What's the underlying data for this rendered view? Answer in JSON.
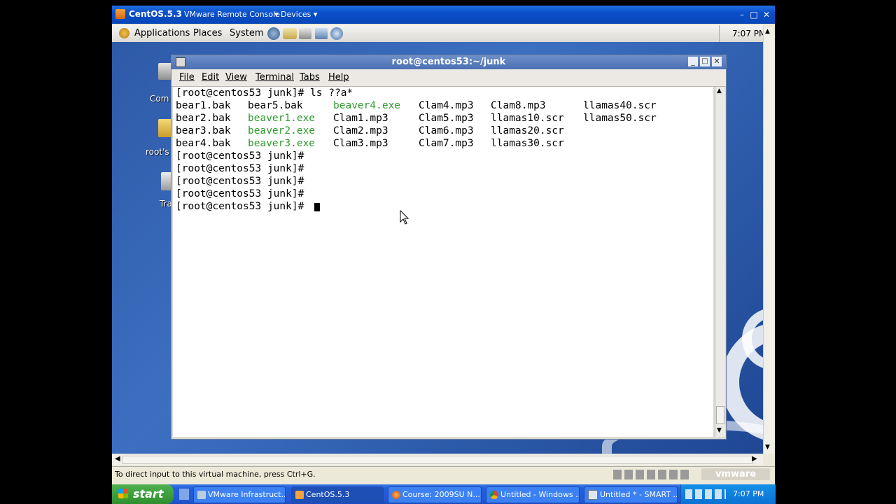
{
  "console": {
    "title": "CentOS.5.3",
    "subtitle": "VMware Remote Console",
    "devices": "Devices",
    "status_text": "To direct input to this virtual machine, press Ctrl+G.",
    "vmware_logo": "vmware"
  },
  "gnome": {
    "menus": [
      "Applications",
      "Places",
      "System"
    ],
    "clock": "7:07 PM",
    "launchers": [
      "network-icon",
      "mail-icon",
      "editor-icon",
      "notes-icon",
      "browser-icon"
    ]
  },
  "desktop": {
    "icons": [
      {
        "label": "Com",
        "icon": "computer-icon"
      },
      {
        "label": "root's",
        "icon": "folder-icon"
      },
      {
        "label": "Tra",
        "icon": "trash-icon"
      }
    ]
  },
  "terminal": {
    "title": "root@centos53:~/junk",
    "menus": [
      "File",
      "Edit",
      "View",
      "Terminal",
      "Tabs",
      "Help"
    ],
    "command_line": "[root@centos53 junk]# ls ??a*",
    "listing": [
      [
        {
          "t": "bear1.bak",
          "g": false
        },
        {
          "t": "bear5.bak",
          "g": false
        },
        {
          "t": "beaver4.exe",
          "g": true
        },
        {
          "t": "Clam4.mp3",
          "g": false
        },
        {
          "t": "Clam8.mp3",
          "g": false
        },
        {
          "t": "llamas40.scr",
          "g": false
        }
      ],
      [
        {
          "t": "bear2.bak",
          "g": false
        },
        {
          "t": "beaver1.exe",
          "g": true
        },
        {
          "t": "Clam1.mp3",
          "g": false
        },
        {
          "t": "Clam5.mp3",
          "g": false
        },
        {
          "t": "llamas10.scr",
          "g": false
        },
        {
          "t": "llamas50.scr",
          "g": false
        }
      ],
      [
        {
          "t": "bear3.bak",
          "g": false
        },
        {
          "t": "beaver2.exe",
          "g": true
        },
        {
          "t": "Clam2.mp3",
          "g": false
        },
        {
          "t": "Clam6.mp3",
          "g": false
        },
        {
          "t": "llamas20.scr",
          "g": false
        },
        {
          "t": "",
          "g": false
        }
      ],
      [
        {
          "t": "bear4.bak",
          "g": false
        },
        {
          "t": "beaver3.exe",
          "g": true
        },
        {
          "t": "Clam3.mp3",
          "g": false
        },
        {
          "t": "Clam7.mp3",
          "g": false
        },
        {
          "t": "llamas30.scr",
          "g": false
        },
        {
          "t": "",
          "g": false
        }
      ]
    ],
    "prompts": [
      "[root@centos53 junk]#",
      "[root@centos53 junk]#",
      "[root@centos53 junk]#",
      "[root@centos53 junk]#",
      "[root@centos53 junk]#"
    ],
    "exe_color": "#2e9a2e"
  },
  "taskbar": {
    "start": "start",
    "tasks": [
      {
        "label": "VMware Infrastruct...",
        "icon": "vmware-icon"
      },
      {
        "label": "CentOS.5.3",
        "icon": "vm-icon"
      },
      {
        "label": "Course: 2009SU N...",
        "icon": "firefox-icon"
      },
      {
        "label": "Untitled - Windows ...",
        "icon": "chrome-icon"
      },
      {
        "label": "Untitled * - SMART ...",
        "icon": "smart-icon"
      }
    ],
    "clock": "7:07 PM"
  }
}
